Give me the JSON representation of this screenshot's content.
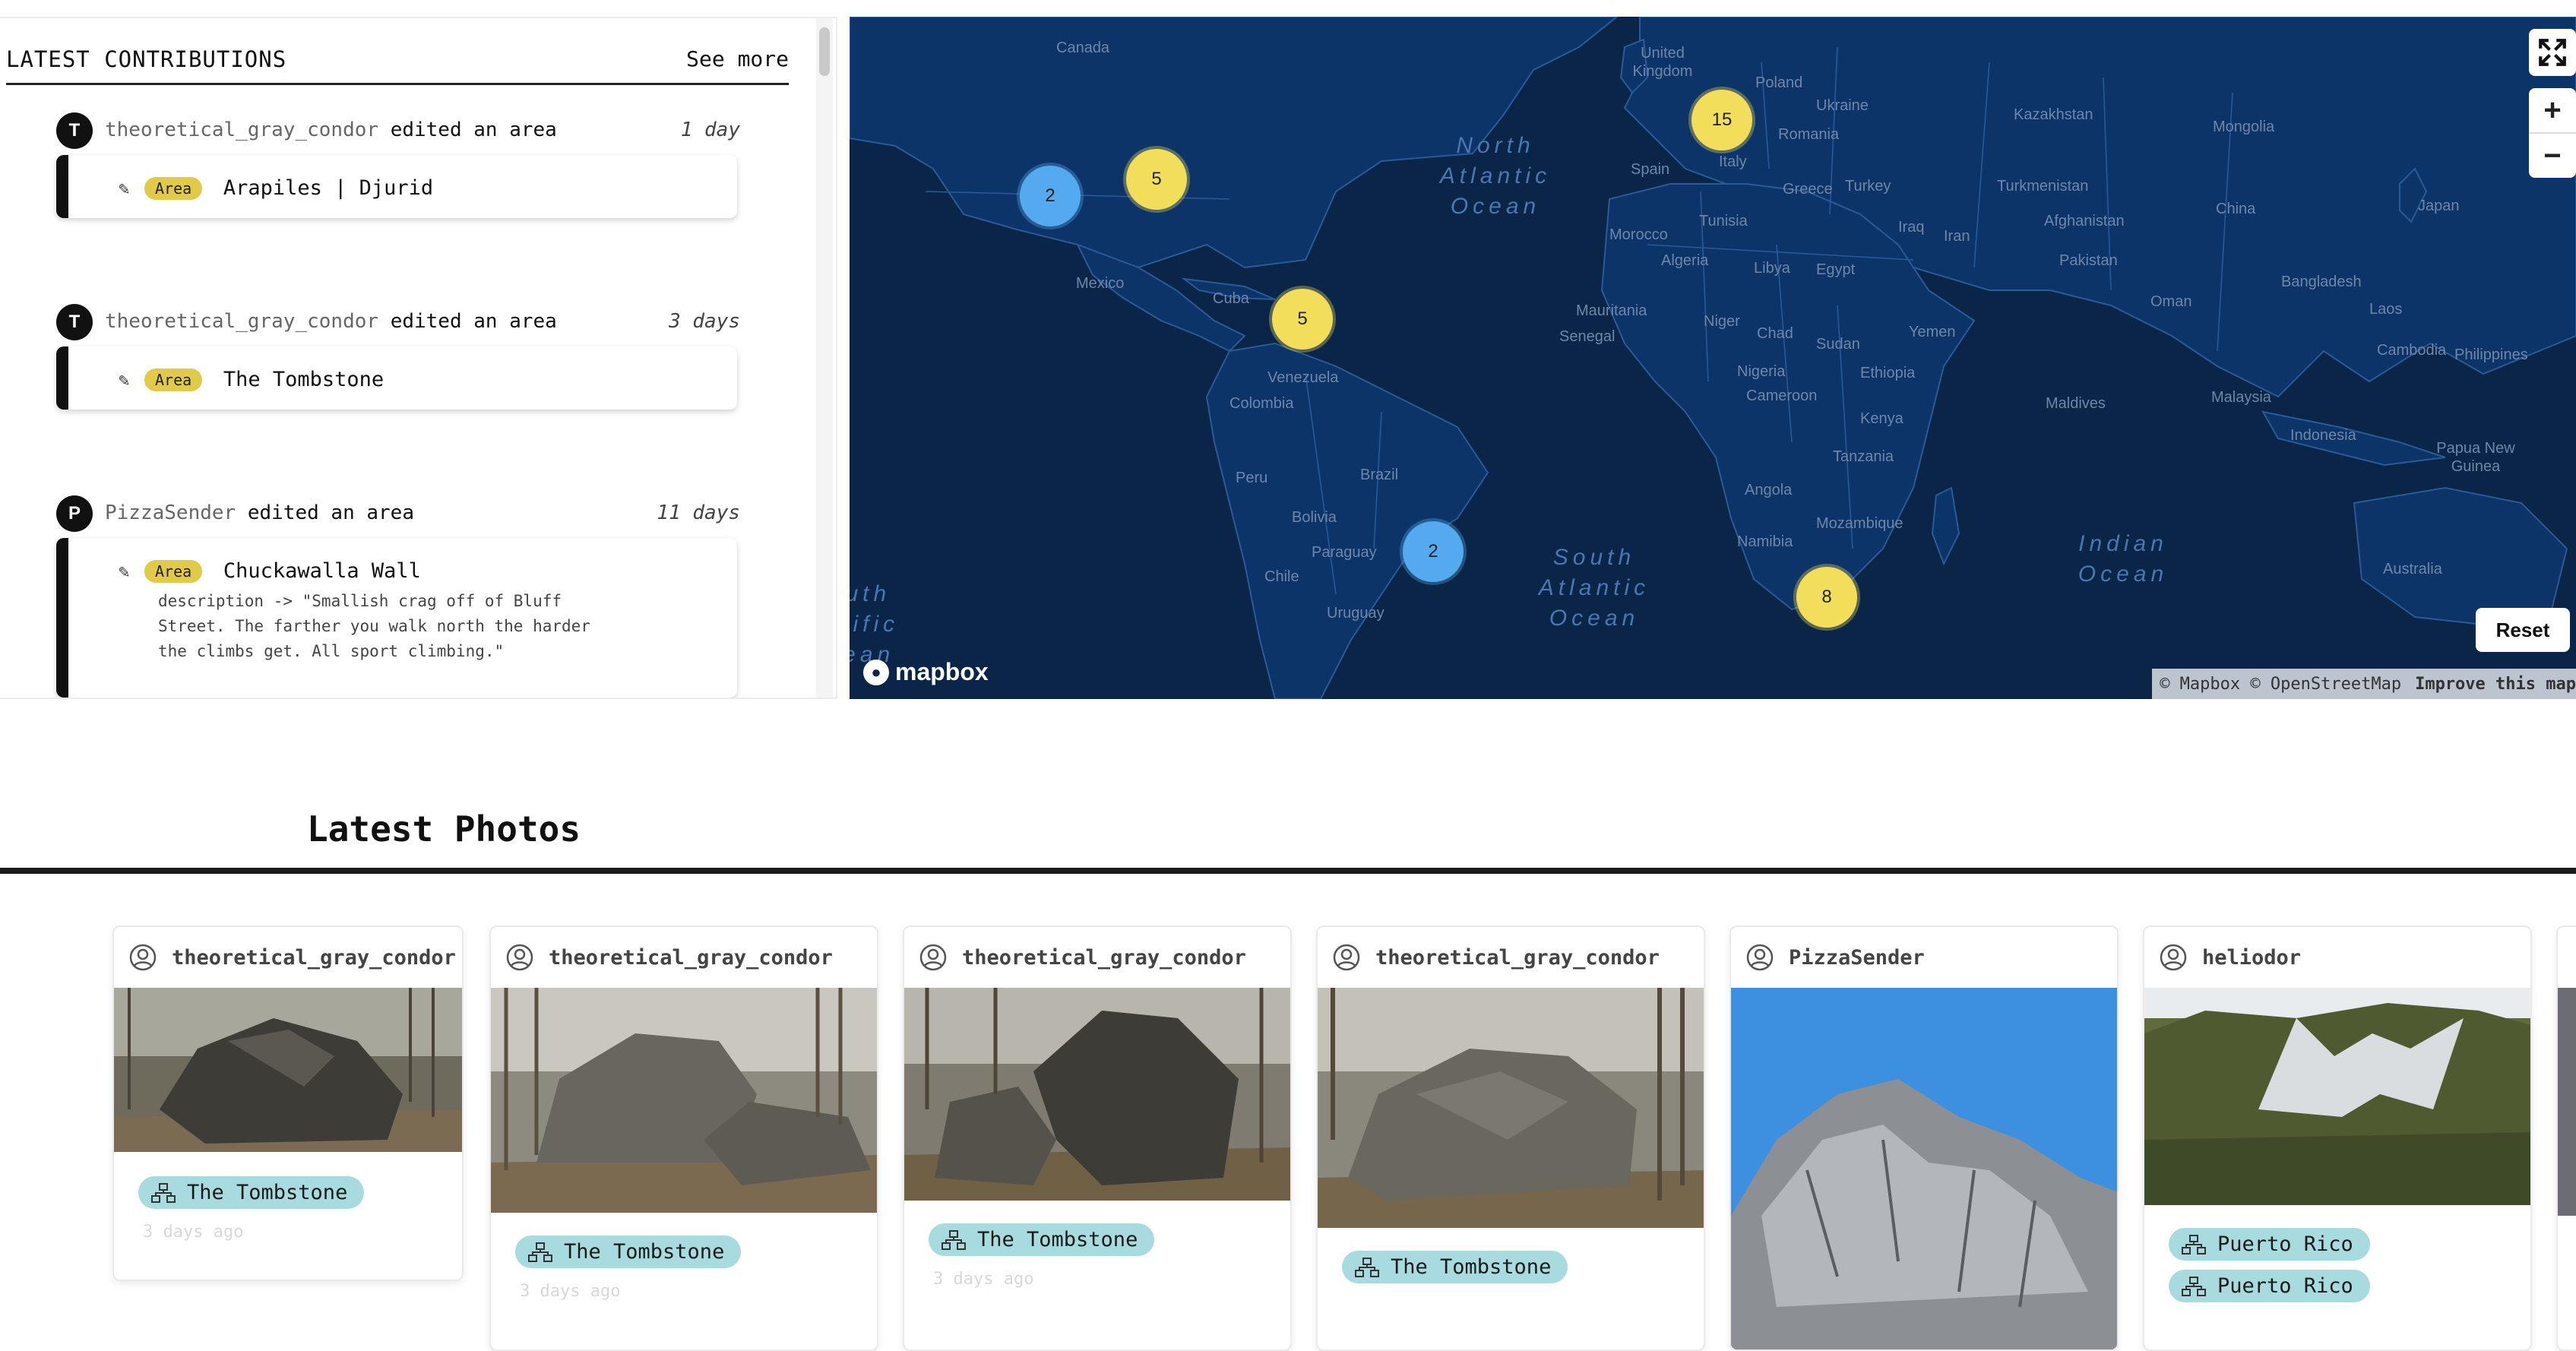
{
  "contributions": {
    "title": "LATEST CONTRIBUTIONS",
    "see_more": "See more",
    "items": [
      {
        "avatar": "T",
        "user": "theoretical_gray_condor",
        "action": "edited an area",
        "age": "1 day",
        "badge": "Area",
        "name": "Arapiles | Djurid",
        "description": ""
      },
      {
        "avatar": "T",
        "user": "theoretical_gray_condor",
        "action": "edited an area",
        "age": "3 days",
        "badge": "Area",
        "name": "The Tombstone",
        "description": ""
      },
      {
        "avatar": "P",
        "user": "PizzaSender",
        "action": "edited an area",
        "age": "11 days",
        "badge": "Area",
        "name": "Chuckawalla Wall",
        "description": "description -> \"Smallish crag off of Bluff\nStreet. The farther you walk north the harder\nthe climbs get. All sport climbing.\""
      }
    ]
  },
  "map": {
    "clusters": [
      {
        "count": "2",
        "color": "blue"
      },
      {
        "count": "5",
        "color": "yellow"
      },
      {
        "count": "15",
        "color": "yellow"
      },
      {
        "count": "5",
        "color": "yellow"
      },
      {
        "count": "2",
        "color": "blue"
      },
      {
        "count": "8",
        "color": "yellow"
      }
    ],
    "labels": [
      "Canada",
      "United Kingdom",
      "Poland",
      "Ukraine",
      "Kazakhstan",
      "Mongolia",
      "Romania",
      "Spain",
      "Italy",
      "Greece",
      "Turkey",
      "Turkmenistan",
      "Afghanistan",
      "China",
      "Japan",
      "Iraq",
      "Iran",
      "Pakistan",
      "Morocco",
      "Tunisia",
      "Algeria",
      "Libya",
      "Egypt",
      "Oman",
      "Bangladesh",
      "Laos",
      "Mexico",
      "Cuba",
      "Mauritania",
      "Senegal",
      "Niger",
      "Chad",
      "Sudan",
      "Yemen",
      "Cambodia",
      "Philippines",
      "Venezuela",
      "Colombia",
      "Nigeria",
      "Ethiopia",
      "Cameroon",
      "Maldives",
      "Malaysia",
      "Kenya",
      "Indonesia",
      "Papua New Guinea",
      "Peru",
      "Brazil",
      "Tanzania",
      "Bolivia",
      "Angola",
      "Paraguay",
      "Mozambique",
      "Chile",
      "Namibia",
      "Uruguay",
      "Australia"
    ],
    "oceans": [
      "North Atlantic Ocean",
      "South Atlantic Ocean",
      "Indian Ocean",
      "South Pacific Ocean"
    ],
    "reset": "Reset",
    "zoom_in": "+",
    "zoom_out": "−",
    "logo": "mapbox",
    "attribution": "© Mapbox © OpenStreetMap",
    "improve": "Improve this map",
    "colors": {
      "ocean": "#0a2547",
      "land": "#0d3468",
      "border": "#2a5a98",
      "cluster_yellow": "#f2de5a",
      "cluster_blue": "#55a9ee"
    }
  },
  "photos": {
    "title": "Latest Photos",
    "cards": [
      {
        "user": "theoretical_gray_condor",
        "tags": [
          "The Tombstone"
        ],
        "time": "3 days ago"
      },
      {
        "user": "theoretical_gray_condor",
        "tags": [
          "The Tombstone"
        ],
        "time": "3 days ago"
      },
      {
        "user": "theoretical_gray_condor",
        "tags": [
          "The Tombstone"
        ],
        "time": "3 days ago"
      },
      {
        "user": "theoretical_gray_condor",
        "tags": [
          "The Tombstone"
        ],
        "time": ""
      },
      {
        "user": "PizzaSender",
        "tags": [],
        "time": ""
      },
      {
        "user": "heliodor",
        "tags": [
          "Puerto Rico",
          "Puerto Rico"
        ],
        "time": ""
      }
    ],
    "tag_color": "#a7dbe0"
  }
}
